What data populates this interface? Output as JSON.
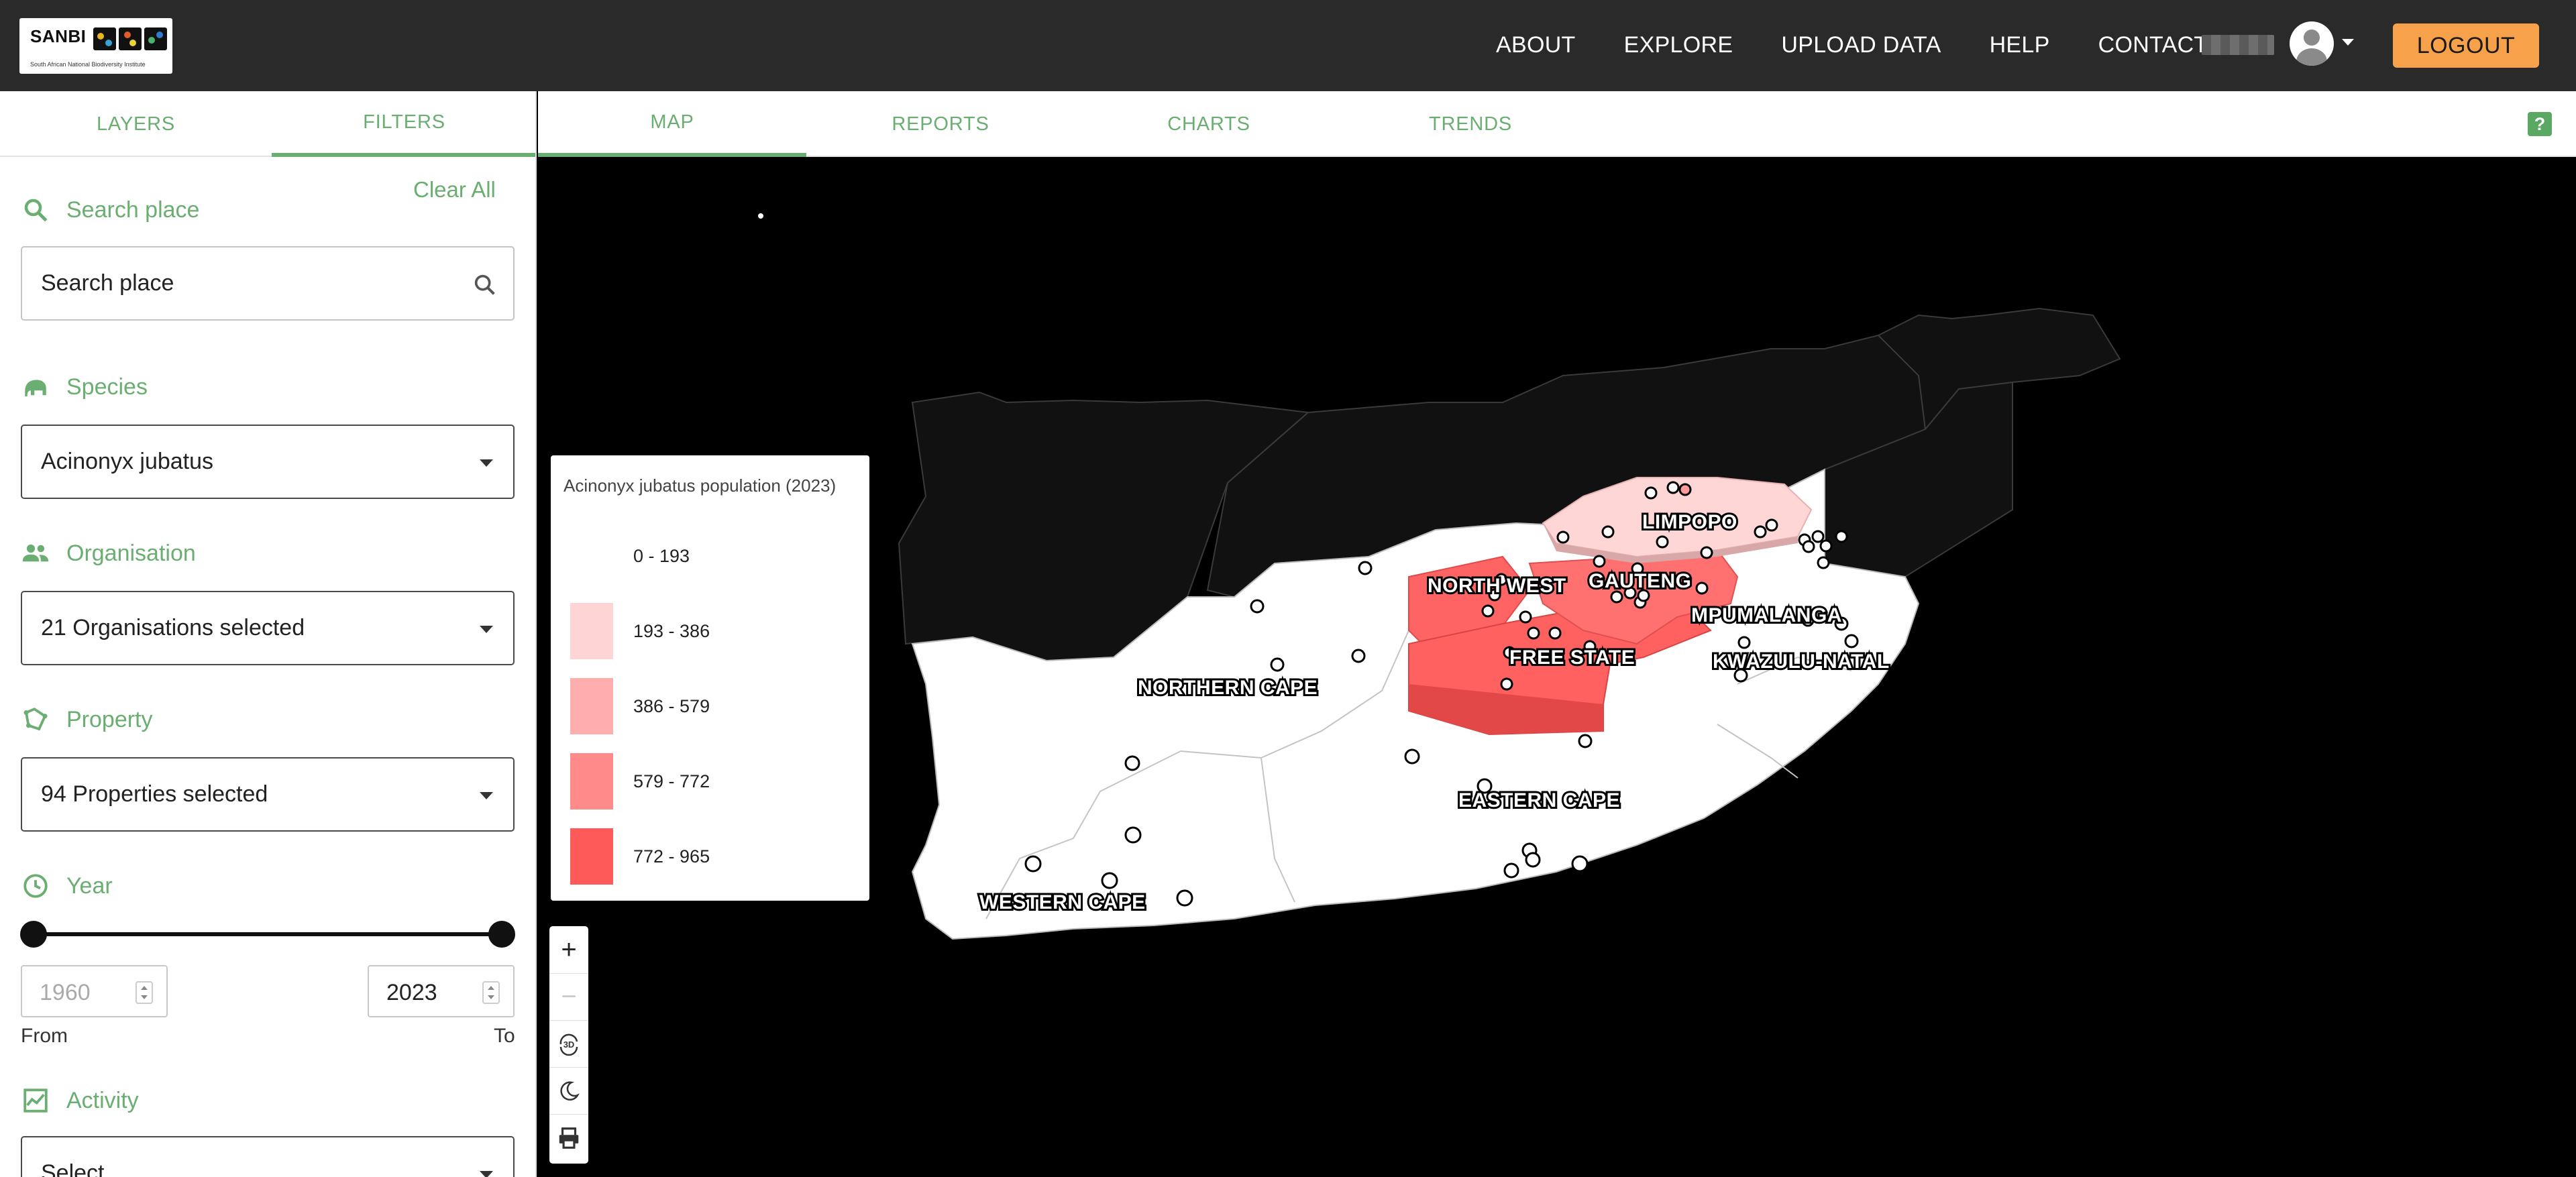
{
  "app": {
    "logo_text": "SANBI",
    "logo_subtitle": "South African National Biodiversity Institute"
  },
  "nav": {
    "links": [
      "ABOUT",
      "EXPLORE",
      "UPLOAD DATA",
      "HELP",
      "CONTACT"
    ],
    "logout_label": "LOGOUT"
  },
  "left_tabs": [
    "LAYERS",
    "FILTERS"
  ],
  "filters": {
    "clear_all": "Clear All",
    "search": {
      "label": "Search place",
      "placeholder": "Search place"
    },
    "species": {
      "label": "Species",
      "value": "Acinonyx jubatus"
    },
    "organisation": {
      "label": "Organisation",
      "value": "21 Organisations selected"
    },
    "property": {
      "label": "Property",
      "value": "94 Properties selected"
    },
    "year": {
      "label": "Year",
      "from_value": "1960",
      "to_value": "2023",
      "from_label": "From",
      "to_label": "To"
    },
    "activity": {
      "label": "Activity",
      "value": "Select"
    }
  },
  "main_tabs": [
    "MAP",
    "REPORTS",
    "CHARTS",
    "TRENDS"
  ],
  "help_label": "?",
  "legend": {
    "title": "Acinonyx jubatus population (2023)",
    "classes": [
      {
        "label": "0 - 193",
        "color": "#ffffff"
      },
      {
        "label": "193 - 386",
        "color": "#ffd4d4"
      },
      {
        "label": "386 - 579",
        "color": "#ffaeae"
      },
      {
        "label": "579 - 772",
        "color": "#ff8a8a"
      },
      {
        "label": "772 - 965",
        "color": "#ff5a5a"
      }
    ]
  },
  "map": {
    "province_labels": [
      "LIMPOPO",
      "NORTH WEST",
      "GAUTENG",
      "MPUMALANGA",
      "FREE STATE",
      "KWAZULU-NATAL",
      "NORTHERN CAPE",
      "EASTERN CAPE",
      "WESTERN CAPE"
    ],
    "controls": [
      "+",
      "−",
      "3D",
      "theme",
      "print"
    ]
  },
  "colors": {
    "accent": "#6bae71",
    "logout": "#f7a14a",
    "topbar": "#2a2a2a"
  }
}
